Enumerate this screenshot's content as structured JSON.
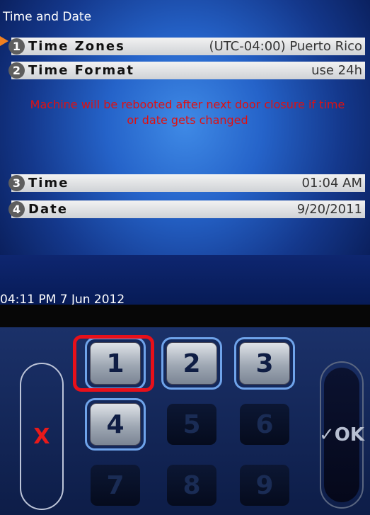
{
  "screen": {
    "title": "Time and Date",
    "warning": "Machine will be rebooted after next door closure if time or date gets changed",
    "clock": "04:11 PM 7 Jun 2012"
  },
  "rows": [
    {
      "num": "1",
      "label": "Time Zones",
      "value": "(UTC-04:00) Puerto Rico"
    },
    {
      "num": "2",
      "label": "Time Format",
      "value": "use 24h"
    },
    {
      "num": "3",
      "label": "Time",
      "value": "01:04 AM"
    },
    {
      "num": "4",
      "label": "Date",
      "value": "9/20/2011"
    }
  ],
  "keypad": {
    "cancel_label": "X",
    "ok_label": "✓OK",
    "keys": [
      "1",
      "2",
      "3",
      "4",
      "5",
      "6",
      "7",
      "8",
      "9"
    ],
    "enabled_keys": [
      "1",
      "2",
      "3",
      "4"
    ],
    "highlighted_key": "1"
  },
  "colors": {
    "warning": "#e01010",
    "highlight": "#e8101a",
    "pointer": "#f08020"
  }
}
